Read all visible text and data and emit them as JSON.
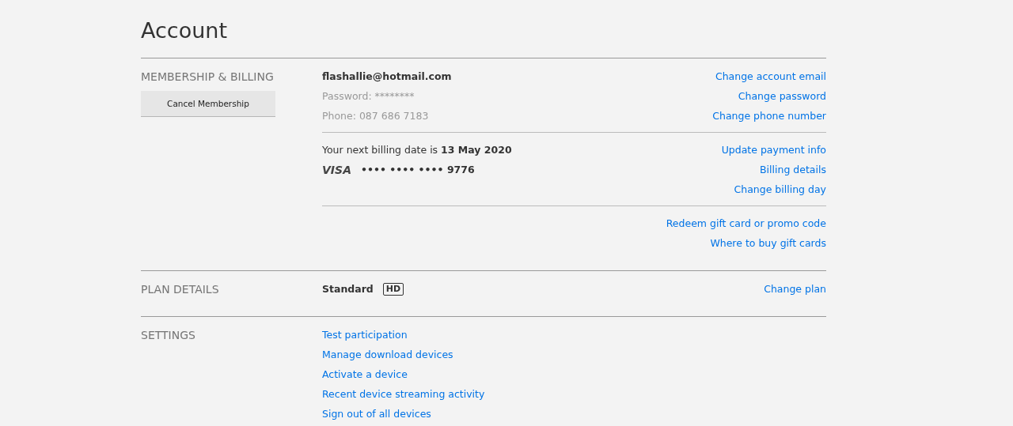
{
  "title": "Account",
  "sections": [
    {
      "heading": "MEMBERSHIP & BILLING",
      "button": "Cancel Membership",
      "groups": [
        {
          "lines": [
            {
              "kind": "bold",
              "text": "flashallie@hotmail.com"
            },
            {
              "kind": "muted",
              "text": "Password: ********"
            },
            {
              "kind": "muted",
              "text": "Phone: 087 686 7183"
            }
          ],
          "links": [
            "Change account email",
            "Change password",
            "Change phone number"
          ]
        },
        {
          "lines": [
            {
              "kind": "rich",
              "text": "Your next billing date is **13 May 2020**"
            },
            {
              "kind": "card",
              "brand": "VISA",
              "text": "•••• •••• •••• 9776"
            }
          ],
          "links": [
            "Update payment info",
            "Billing details",
            "Change billing day"
          ]
        },
        {
          "links": [
            "Redeem gift card or promo code",
            "Where to buy gift cards"
          ]
        }
      ]
    },
    {
      "heading": "PLAN DETAILS",
      "groups": [
        {
          "lines": [
            {
              "kind": "plan",
              "text": "Standard",
              "badge": "HD"
            }
          ],
          "links": [
            "Change plan"
          ]
        }
      ]
    },
    {
      "heading": "SETTINGS",
      "groups": [
        {
          "lines": [
            {
              "kind": "link",
              "text": "Test participation"
            },
            {
              "kind": "link",
              "text": "Manage download devices"
            },
            {
              "kind": "link",
              "text": "Activate a device"
            },
            {
              "kind": "link",
              "text": "Recent device streaming activity"
            },
            {
              "kind": "link",
              "text": "Sign out of all devices"
            }
          ]
        }
      ]
    }
  ]
}
